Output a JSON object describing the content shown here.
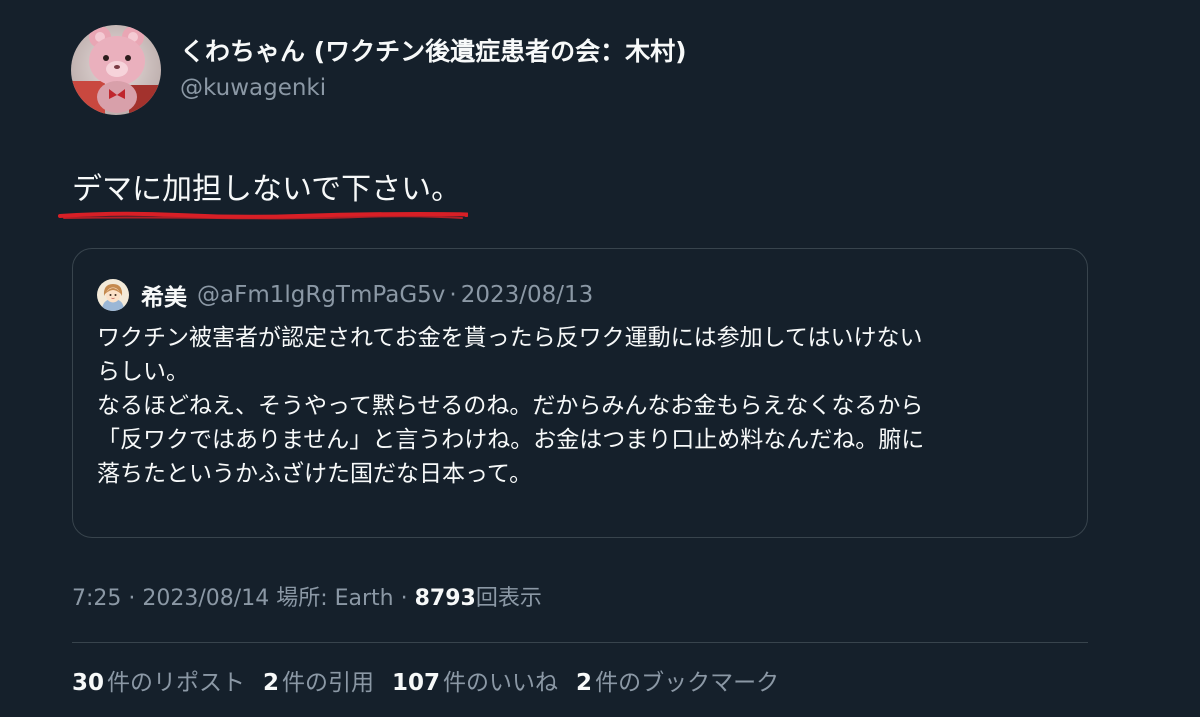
{
  "author": {
    "name": "くわちゃん (ワクチン後遺症患者の会：木村)",
    "handle": "@kuwagenki",
    "avatar_icon": "pink-bear-avatar-icon"
  },
  "tweet": {
    "text": "デマに加担しないで下さい。",
    "underline_color": "#d81f26"
  },
  "quote": {
    "avatar_icon": "girl-avatar-icon",
    "name": "希美",
    "handle": "@aFm1lgRgTmPaG5v",
    "separator": "·",
    "date": "2023/08/13",
    "lines": [
      "ワクチン被害者が認定されてお金を貰ったら反ワク運動には参加してはいけない",
      "らしい。",
      "なるほどねえ、そうやって黙らせるのね。だからみんなお金もらえなくなるから",
      "「反ワクではありません」と言うわけね。お金はつまり口止め料なんだね。腑に",
      "落ちたというかふざけた国だな日本って。"
    ]
  },
  "meta": {
    "time": "7:25",
    "sep1": "·",
    "date": "2023/08/14",
    "location": "場所: Earth",
    "sep2": "·",
    "views": "8793",
    "views_label": "回表示"
  },
  "stats": {
    "retweets": {
      "count": "30",
      "label": "件のリポスト"
    },
    "quotes": {
      "count": "2",
      "label": "件の引用"
    },
    "likes": {
      "count": "107",
      "label": "件のいいね"
    },
    "bookmarks": {
      "count": "2",
      "label": "件のブックマーク"
    }
  },
  "colors": {
    "background": "#15202b",
    "text_primary": "#f7f9f9",
    "text_secondary": "#8b98a5",
    "border": "#38444d"
  }
}
